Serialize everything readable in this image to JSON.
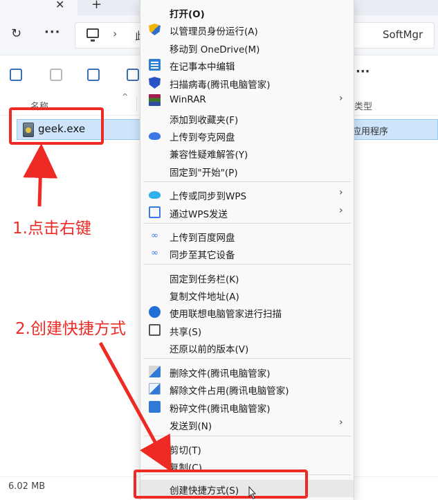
{
  "explorer": {
    "tab_close": "✕",
    "tab_new": "+",
    "refresh": "↻",
    "more": "···",
    "address": {
      "segment_visible_left": "此",
      "segment_visible_right": "SoftMgr",
      "chevron": "›"
    },
    "toolbar_more": "···",
    "columns": {
      "name": "名称",
      "type": "类型",
      "sort_indicator": "^"
    },
    "file": {
      "name": "geek.exe",
      "type": "应用程序"
    },
    "status": {
      "size": "6.02 MB"
    }
  },
  "context_menu": {
    "items": [
      {
        "label": "打开(O)",
        "icon": "none",
        "bold": true,
        "submenu": false
      },
      {
        "label": "以管理员身份运行(A)",
        "icon": "uac-shield-icon",
        "submenu": false
      },
      {
        "label": "移动到 OneDrive(M)",
        "icon": "none",
        "submenu": false
      },
      {
        "label": "在记事本中编辑",
        "icon": "notepad-icon",
        "submenu": false
      },
      {
        "label": "扫描病毒(腾讯电脑管家)",
        "icon": "tencent-shield-icon",
        "submenu": false
      },
      {
        "label": "WinRAR",
        "icon": "winrar-icon",
        "submenu": true
      },
      {
        "label": "添加到收藏夹(F)",
        "icon": "none",
        "submenu": false
      },
      {
        "label": "上传到夸克网盘",
        "icon": "quark-cloud-icon",
        "submenu": false
      },
      {
        "label": "兼容性疑难解答(Y)",
        "icon": "none",
        "submenu": false
      },
      {
        "label": "固定到\"开始\"(P)",
        "icon": "none",
        "submenu": false
      },
      {
        "label": "上传或同步到WPS",
        "icon": "wps-cloud-icon",
        "submenu": true
      },
      {
        "label": "通过WPS发送",
        "icon": "wps-send-icon",
        "submenu": true
      },
      {
        "label": "上传到百度网盘",
        "icon": "baidu-cloud-icon",
        "submenu": false
      },
      {
        "label": "同步至其它设备",
        "icon": "baidu-sync-icon",
        "submenu": false
      },
      {
        "label": "固定到任务栏(K)",
        "icon": "none",
        "submenu": false
      },
      {
        "label": "复制文件地址(A)",
        "icon": "none",
        "submenu": false
      },
      {
        "label": "使用联想电脑管家进行扫描",
        "icon": "lenovo-icon",
        "submenu": false
      },
      {
        "label": "共享(S)",
        "icon": "share-icon",
        "submenu": false
      },
      {
        "label": "还原以前的版本(V)",
        "icon": "none",
        "submenu": false
      },
      {
        "label": "删除文件(腾讯电脑管家)",
        "icon": "delete-broom-icon",
        "submenu": false
      },
      {
        "label": "解除文件占用(腾讯电脑管家)",
        "icon": "unlock-file-icon",
        "submenu": false
      },
      {
        "label": "粉碎文件(腾讯电脑管家)",
        "icon": "shred-icon",
        "submenu": false
      },
      {
        "label": "发送到(N)",
        "icon": "none",
        "submenu": true
      },
      {
        "label": "剪切(T)",
        "icon": "none",
        "submenu": false
      },
      {
        "label": "复制(C)",
        "icon": "none",
        "submenu": false
      },
      {
        "label": "创建快捷方式(S)",
        "icon": "none",
        "submenu": false,
        "hovered": true
      }
    ],
    "submenu_arrow": "›"
  },
  "annotations": {
    "step1": "1.点击右键",
    "step2": "2.创建快捷方式",
    "color": "#ee2a24"
  },
  "colors": {
    "selection": "#cde4fa",
    "menu_bg": "#f9f9f9",
    "accent": "#3b78e7"
  }
}
